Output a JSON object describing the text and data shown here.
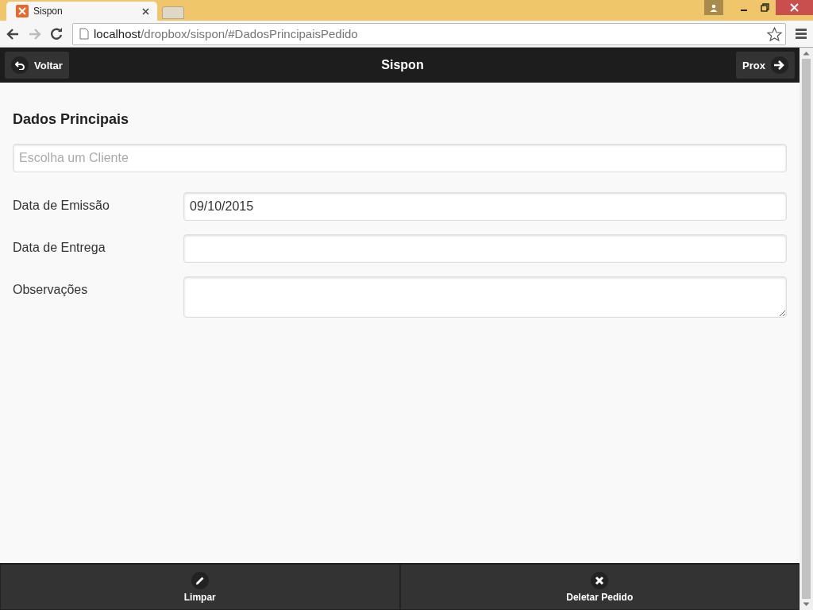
{
  "browser": {
    "tab_title": "Sispon",
    "url_host": "localhost",
    "url_path": "/dropbox/sispon/#DadosPrincipaisPedido"
  },
  "header": {
    "back": "Voltar",
    "title": "Sispon",
    "next": "Prox"
  },
  "section_title": "Dados Principais",
  "client_field": {
    "placeholder": "Escolha um Cliente"
  },
  "fields": [
    {
      "label": "Data de Emissão",
      "value": "09/10/2015",
      "kind": "input"
    },
    {
      "label": "Data de Entrega",
      "kind": "input"
    },
    {
      "label": "Observações",
      "kind": "textarea"
    }
  ],
  "footer": [
    {
      "label": "Limpar",
      "kind": "edit"
    },
    {
      "label": "Deletar Pedido",
      "kind": "delete"
    }
  ]
}
